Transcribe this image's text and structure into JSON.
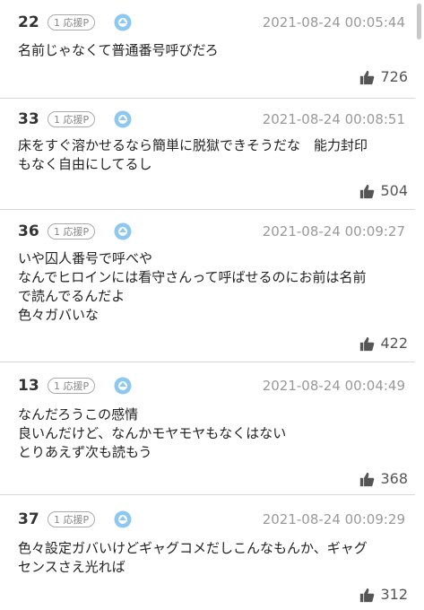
{
  "comments": [
    {
      "number": "22",
      "badge": "1 応援P",
      "date": "2021-08-24 00:05:44",
      "lines": [
        "名前じゃなくて普通番号呼びだろ"
      ],
      "likes": "726"
    },
    {
      "number": "33",
      "badge": "1 応援P",
      "date": "2021-08-24 00:08:51",
      "lines": [
        "床をすぐ溶かせるなら簡単に脱獄できそうだな　能力封印",
        "もなく自由にしてるし"
      ],
      "likes": "504"
    },
    {
      "number": "36",
      "badge": "1 応援P",
      "date": "2021-08-24 00:09:27",
      "lines": [
        "いや囚人番号で呼べや",
        "なんでヒロインには看守さんって呼ばせるのにお前は名前",
        "で読んでるんだよ",
        "色々ガバいな"
      ],
      "likes": "422"
    },
    {
      "number": "13",
      "badge": "1 応援P",
      "date": "2021-08-24 00:04:49",
      "lines": [
        "なんだろうこの感情",
        "良いんだけど、なんかモヤモヤもなくはない",
        "とりあえず次も読もう"
      ],
      "likes": "368"
    },
    {
      "number": "37",
      "badge": "1 応援P",
      "date": "2021-08-24 00:09:29",
      "lines": [
        "色々設定ガバいけどギャグコメだしこんなもんか、ギャグ",
        "センスさえ光れば"
      ],
      "likes": "312"
    }
  ]
}
